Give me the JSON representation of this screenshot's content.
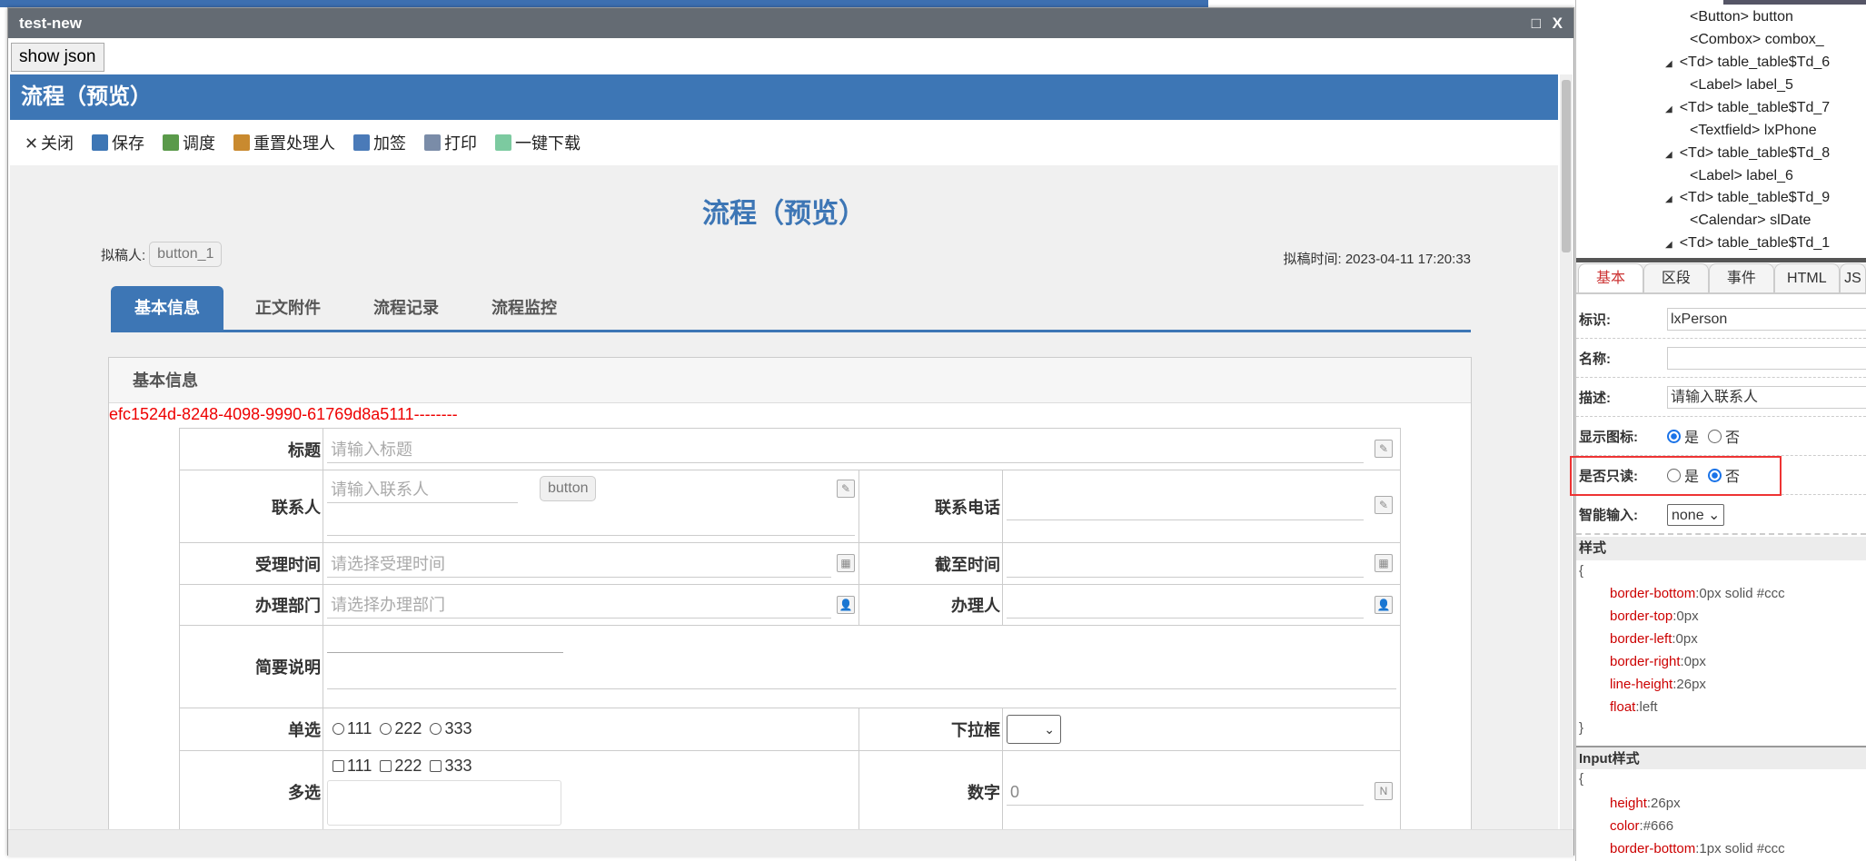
{
  "window": {
    "title": "test-new",
    "maximize_icon": "□",
    "close_icon": "X"
  },
  "show_json": "show json",
  "header": {
    "title": "流程（预览）"
  },
  "toolbar": [
    {
      "label": "关闭",
      "icon": "close-icon",
      "color": "#333"
    },
    {
      "label": "保存",
      "icon": "save-icon",
      "color": "#3d76b5"
    },
    {
      "label": "调度",
      "icon": "dispatch-icon",
      "color": "#5a9a4a"
    },
    {
      "label": "重置处理人",
      "icon": "reset-handler-icon",
      "color": "#c98a2f"
    },
    {
      "label": "加签",
      "icon": "add-sign-icon",
      "color": "#4a7ab8"
    },
    {
      "label": "打印",
      "icon": "print-icon",
      "color": "#7a8ca8"
    },
    {
      "label": "一键下载",
      "icon": "download-icon",
      "color": "#7ccaa0"
    }
  ],
  "page": {
    "title": "流程（预览）",
    "drafter_label": "拟稿人:",
    "drafter_button": "button_1",
    "draft_time_label": "拟稿时间:",
    "draft_time": "2023-04-11 17:20:33"
  },
  "tabs": [
    "基本信息",
    "正文附件",
    "流程记录",
    "流程监控"
  ],
  "section": {
    "title": "基本信息",
    "uuid": "efc1524d-8248-4098-9990-61769d8a5111--------"
  },
  "form": {
    "title_label": "标题",
    "title_placeholder": "请输入标题",
    "contact_label": "联系人",
    "contact_placeholder": "请输入联系人",
    "contact_button": "button",
    "phone_label": "联系电话",
    "accept_time_label": "受理时间",
    "accept_time_placeholder": "请选择受理时间",
    "deadline_label": "截至时间",
    "dept_label": "办理部门",
    "dept_placeholder": "请选择办理部门",
    "handler_label": "办理人",
    "summary_label": "简要说明",
    "radio_label": "单选",
    "radio_options": [
      "111",
      "222",
      "333"
    ],
    "select_label": "下拉框",
    "checkbox_label": "多选",
    "checkbox_options": [
      "111",
      "222",
      "333"
    ],
    "number_label": "数字",
    "number_value": "0"
  },
  "tree": [
    {
      "text": "<Button> button",
      "level": 2
    },
    {
      "text": "<Combox> combox_",
      "level": 2
    },
    {
      "text": "<Td> table_table$Td_6",
      "level": 1
    },
    {
      "text": "<Label> label_5",
      "level": 2
    },
    {
      "text": "<Td> table_table$Td_7",
      "level": 1
    },
    {
      "text": "<Textfield> lxPhone",
      "level": 2
    },
    {
      "text": "<Td> table_table$Td_8",
      "level": 1
    },
    {
      "text": "<Label> label_6",
      "level": 2
    },
    {
      "text": "<Td> table_table$Td_9",
      "level": 1
    },
    {
      "text": "<Calendar> slDate",
      "level": 2
    },
    {
      "text": "<Td> table_table$Td_1",
      "level": 1
    }
  ],
  "props": {
    "tabs": [
      "基本",
      "区段",
      "事件",
      "HTML",
      "JS"
    ],
    "id_label": "标识:",
    "id_value": "lxPerson",
    "name_label": "名称:",
    "name_value": "",
    "desc_label": "描述:",
    "desc_value": "请输入联系人",
    "show_icon_label": "显示图标:",
    "yes": "是",
    "no": "否",
    "readonly_label": "是否只读:",
    "smart_label": "智能输入:",
    "smart_value": "none",
    "style_header": "样式",
    "style": [
      [
        "border-bottom",
        "0px solid #ccc"
      ],
      [
        "border-top",
        "0px"
      ],
      [
        "border-left",
        "0px"
      ],
      [
        "border-right",
        "0px"
      ],
      [
        "line-height",
        "26px"
      ],
      [
        "float",
        "left"
      ]
    ],
    "input_style_header": "Input样式",
    "input_style": [
      [
        "height",
        "26px"
      ],
      [
        "color",
        "#666"
      ],
      [
        "border-bottom",
        "1px solid #ccc"
      ]
    ],
    "open_brace": "{",
    "close_brace": "}"
  }
}
